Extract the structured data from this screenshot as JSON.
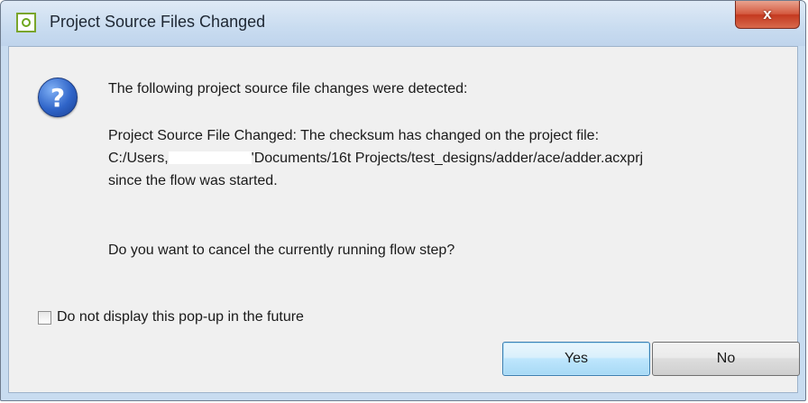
{
  "window": {
    "title": "Project Source Files Changed",
    "close_label": "x"
  },
  "message": {
    "header": "The following project source file changes were detected:",
    "detail_line1": "Project Source File Changed:  The checksum has changed on the project file:",
    "path_prefix": "C:/Users,",
    "path_suffix": "'Documents/16t Projects/test_designs/adder/ace/adder.acxprj",
    "detail_line3": "since the flow was started.",
    "question": "Do you want to cancel the currently running flow step?"
  },
  "checkbox": {
    "label": "Do not display this pop-up in the future",
    "checked": false
  },
  "buttons": {
    "yes": "Yes",
    "no": "No"
  },
  "icons": {
    "app": "app-icon",
    "question": "question-icon",
    "close": "close-icon"
  },
  "colors": {
    "titlebar": "#c9dcf0",
    "close_button": "#c4391f",
    "default_button_border": "#3c7fb1",
    "question_icon": "#2f64c8"
  }
}
